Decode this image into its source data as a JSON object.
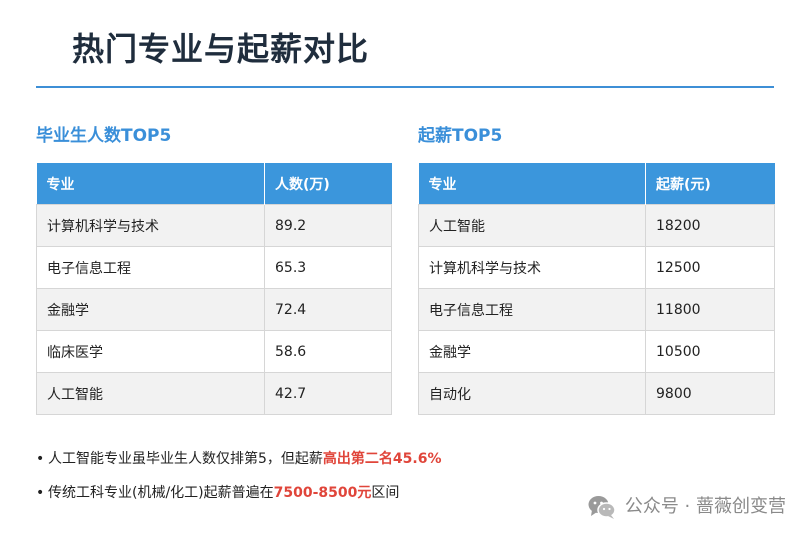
{
  "page": {
    "title": "热门专业与起薪对比"
  },
  "graduates": {
    "title": "毕业生人数TOP5",
    "headers": [
      "专业",
      "人数(万)"
    ],
    "rows": [
      [
        "计算机科学与技术",
        "89.2"
      ],
      [
        "电子信息工程",
        "65.3"
      ],
      [
        "金融学",
        "72.4"
      ],
      [
        "临床医学",
        "58.6"
      ],
      [
        "人工智能",
        "42.7"
      ]
    ]
  },
  "salary": {
    "title": "起薪TOP5",
    "headers": [
      "专业",
      "起薪(元)"
    ],
    "rows": [
      [
        "人工智能",
        "18200"
      ],
      [
        "计算机科学与技术",
        "12500"
      ],
      [
        "电子信息工程",
        "11800"
      ],
      [
        "金融学",
        "10500"
      ],
      [
        "自动化",
        "9800"
      ]
    ]
  },
  "notes": [
    {
      "bullet": "•",
      "text": "人工智能专业虽毕业生人数仅排第5，但起薪",
      "highlight": "高出第二名45.6%",
      "suffix": ""
    },
    {
      "bullet": "•",
      "text": "传统工科专业(机械/化工)起薪普遍在",
      "highlight": "7500-8500元",
      "suffix": "区间"
    }
  ],
  "watermark": {
    "text": "公众号 · 蔷薇创变营",
    "icon": "wechat-icon"
  },
  "colors": {
    "accent": "#3b96dc",
    "title": "#1f2d3d",
    "highlight": "#e0453a",
    "stripe": "#f2f2f2"
  }
}
